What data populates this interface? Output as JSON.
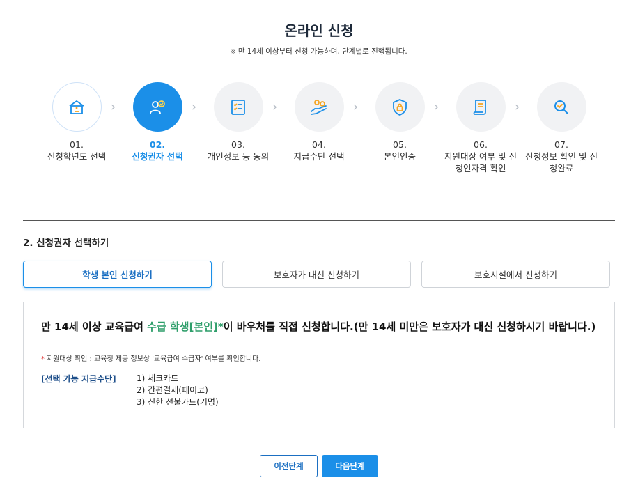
{
  "header": {
    "title": "온라인 신청",
    "subtitle_mark": "※",
    "subtitle": "만 14세 이상부터 신청 가능하며, 단계별로 진행됩니다."
  },
  "steps": [
    {
      "num": "01.",
      "label": "신청학년도 선택",
      "icon": "school-building-icon"
    },
    {
      "num": "02.",
      "label": "신청권자 선택",
      "icon": "user-check-icon"
    },
    {
      "num": "03.",
      "label": "개인정보 등 동의",
      "icon": "checklist-icon"
    },
    {
      "num": "04.",
      "label": "지급수단 선택",
      "icon": "hand-coins-icon"
    },
    {
      "num": "05.",
      "label": "본인인증",
      "icon": "shield-lock-icon"
    },
    {
      "num": "06.",
      "label": "지원대상 여부 및 신청인자격 확인",
      "icon": "document-scroll-icon"
    },
    {
      "num": "07.",
      "label": "신청정보 확인 및 신청완료",
      "icon": "magnifier-check-icon"
    }
  ],
  "section": {
    "title": "2. 신청권자 선택하기",
    "options": [
      "학생 본인 신청하기",
      "보호자가 대신 신청하기",
      "보호시설에서 신청하기"
    ]
  },
  "info": {
    "headline_pre": "만 14세 이상 교육급여 ",
    "headline_highlight": "수급 학생[본인]*",
    "headline_post": "이 바우처를 직접 신청합니다.(만 14세 미만은 보호자가 대신 신청하시기 바랍니다.)",
    "note_star": "*",
    "note": "지원대상 확인 : 교육청 제공 정보상 '교육급여 수급자' 여부를 확인합니다.",
    "pay_label": "[선택 가능 지급수단]",
    "pay_methods": [
      "1) 체크카드",
      "2) 간편결제(페이코)",
      "3) 신한 선불카드(기명)"
    ]
  },
  "buttons": {
    "prev": "이전단계",
    "next": "다음단계"
  },
  "colors": {
    "accent": "#1b8fe8",
    "highlight_green": "#2e9e6a",
    "note_red": "#e03a3a",
    "pay_label_blue": "#1e4f8a"
  }
}
